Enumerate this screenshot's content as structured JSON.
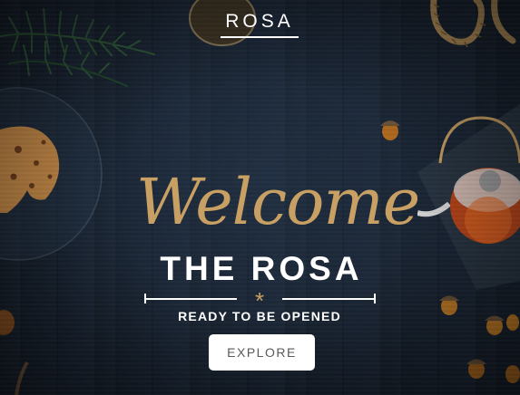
{
  "brand": {
    "name": "ROSA"
  },
  "hero": {
    "script_heading": "Welcome",
    "title": "THE ROSA",
    "subtitle": "READY TO BE OPENED",
    "divider_icon": "asterisk-icon"
  },
  "cta": {
    "label": "EXPLORE"
  },
  "colors": {
    "background": "#17202c",
    "accent_gold": "#c9a063",
    "text": "#ffffff",
    "button_bg": "#ffffff",
    "button_text": "#5a5a5a"
  },
  "icons": [
    "pine-branch-icon",
    "cookie-icon",
    "glass-plate-icon",
    "rope-icon",
    "teapot-icon",
    "slate-board-icon",
    "acorn-icon",
    "tea-glass-icon"
  ]
}
